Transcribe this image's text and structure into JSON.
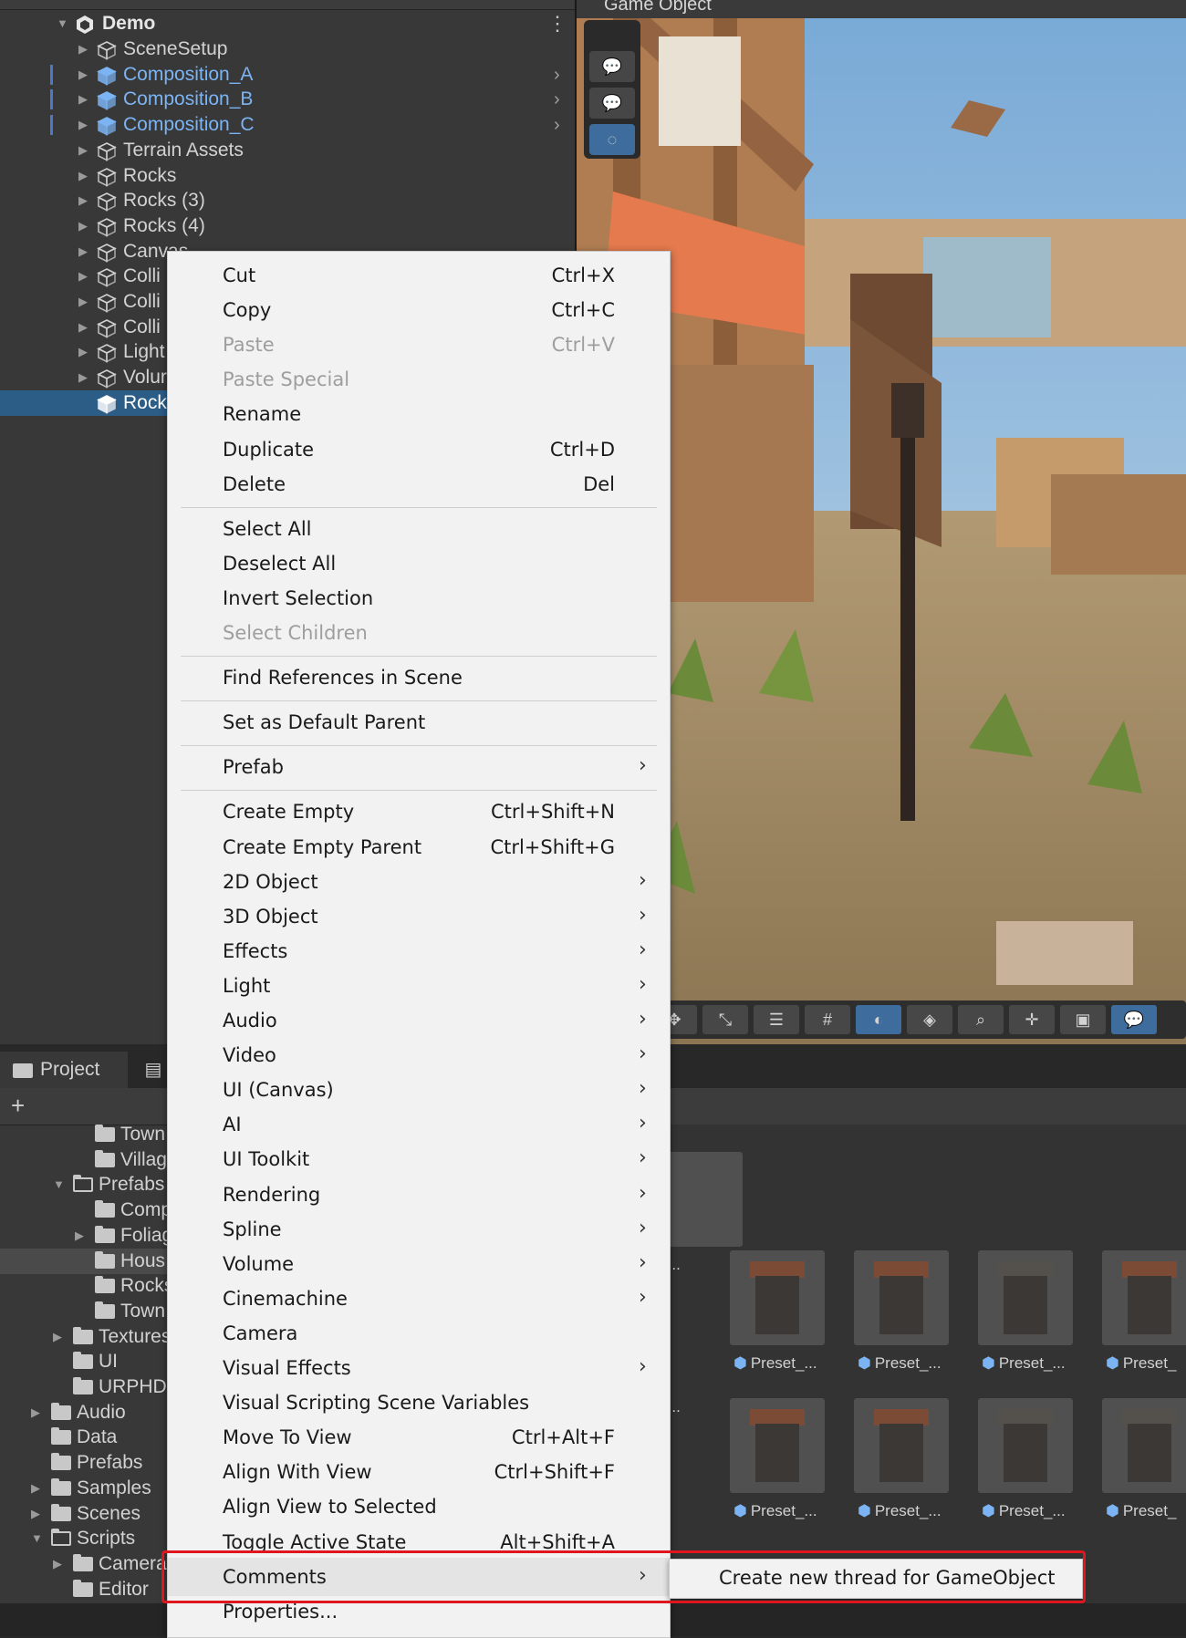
{
  "hierarchy": {
    "root": "Demo",
    "items": [
      {
        "label": "SceneSetup",
        "type": "normal"
      },
      {
        "label": "Composition_A",
        "type": "prefab"
      },
      {
        "label": "Composition_B",
        "type": "prefab"
      },
      {
        "label": "Composition_C",
        "type": "prefab"
      },
      {
        "label": "Terrain Assets",
        "type": "normal"
      },
      {
        "label": "Rocks",
        "type": "normal"
      },
      {
        "label": "Rocks (3)",
        "type": "normal"
      },
      {
        "label": "Rocks (4)",
        "type": "normal"
      },
      {
        "label": "Canvas",
        "type": "normal"
      },
      {
        "label": "Colli",
        "type": "normal"
      },
      {
        "label": "Colli",
        "type": "normal"
      },
      {
        "label": "Colli",
        "type": "normal"
      },
      {
        "label": "Light",
        "type": "normal"
      },
      {
        "label": "Volur",
        "type": "normal"
      },
      {
        "label": "Rock",
        "type": "selected"
      }
    ]
  },
  "scene": {
    "toolbar_label": "Game Object"
  },
  "project": {
    "tab_label": "Project",
    "add_label": "+",
    "tree": [
      {
        "label": "Town",
        "indent": 2
      },
      {
        "label": "Villag",
        "indent": 2
      },
      {
        "label": "Prefabs",
        "indent": 1,
        "open": true
      },
      {
        "label": "Comp",
        "indent": 2
      },
      {
        "label": "Foliag",
        "indent": 2
      },
      {
        "label": "Hous",
        "indent": 2
      },
      {
        "label": "Rocks",
        "indent": 2
      },
      {
        "label": "Town",
        "indent": 2
      },
      {
        "label": "Textures",
        "indent": 1
      },
      {
        "label": "UI",
        "indent": 1
      },
      {
        "label": "URPHD",
        "indent": 1
      },
      {
        "label": "Audio",
        "indent": 0
      },
      {
        "label": "Data",
        "indent": 0
      },
      {
        "label": "Prefabs",
        "indent": 0
      },
      {
        "label": "Samples",
        "indent": 0
      },
      {
        "label": "Scenes",
        "indent": 0
      },
      {
        "label": "Scripts",
        "indent": 0,
        "open": true
      },
      {
        "label": "Camera",
        "indent": 1
      },
      {
        "label": "Editor",
        "indent": 1
      }
    ],
    "asset_row1_left_caption": "et_...",
    "asset_row2_left_caption": "et_...",
    "assets": [
      "Preset_...",
      "Preset_...",
      "Preset_...",
      "Preset_"
    ]
  },
  "menu": {
    "items": [
      {
        "label": "Cut",
        "shortcut": "Ctrl+X"
      },
      {
        "label": "Copy",
        "shortcut": "Ctrl+C"
      },
      {
        "label": "Paste",
        "shortcut": "Ctrl+V",
        "disabled": true
      },
      {
        "label": "Paste Special",
        "disabled": true
      },
      {
        "label": "Rename"
      },
      {
        "label": "Duplicate",
        "shortcut": "Ctrl+D"
      },
      {
        "label": "Delete",
        "shortcut": "Del"
      },
      {
        "sep": true
      },
      {
        "label": "Select All"
      },
      {
        "label": "Deselect All"
      },
      {
        "label": "Invert Selection"
      },
      {
        "label": "Select Children",
        "disabled": true
      },
      {
        "sep": true
      },
      {
        "label": "Find References in Scene"
      },
      {
        "sep": true
      },
      {
        "label": "Set as Default Parent"
      },
      {
        "sep": true
      },
      {
        "label": "Prefab",
        "submenu": true
      },
      {
        "sep": true
      },
      {
        "label": "Create Empty",
        "shortcut": "Ctrl+Shift+N"
      },
      {
        "label": "Create Empty Parent",
        "shortcut": "Ctrl+Shift+G"
      },
      {
        "label": "2D Object",
        "submenu": true
      },
      {
        "label": "3D Object",
        "submenu": true
      },
      {
        "label": "Effects",
        "submenu": true
      },
      {
        "label": "Light",
        "submenu": true
      },
      {
        "label": "Audio",
        "submenu": true
      },
      {
        "label": "Video",
        "submenu": true
      },
      {
        "label": "UI (Canvas)",
        "submenu": true
      },
      {
        "label": "AI",
        "submenu": true
      },
      {
        "label": "UI Toolkit",
        "submenu": true
      },
      {
        "label": "Rendering",
        "submenu": true
      },
      {
        "label": "Spline",
        "submenu": true
      },
      {
        "label": "Volume",
        "submenu": true
      },
      {
        "label": "Cinemachine",
        "submenu": true
      },
      {
        "label": "Camera"
      },
      {
        "label": "Visual Effects",
        "submenu": true
      },
      {
        "label": "Visual Scripting Scene Variables"
      },
      {
        "label": "Move To View",
        "shortcut": "Ctrl+Alt+F"
      },
      {
        "label": "Align With View",
        "shortcut": "Ctrl+Shift+F"
      },
      {
        "label": "Align View to Selected"
      },
      {
        "label": "Toggle Active State",
        "shortcut": "Alt+Shift+A"
      },
      {
        "label": "Comments",
        "submenu": true,
        "highlighted": true
      },
      {
        "label": "Properties..."
      }
    ]
  },
  "submenu": {
    "label": "Create new thread for GameObject"
  },
  "colors": {
    "annotation": "#e0161f",
    "prefab_text": "#7cb4f3",
    "selection": "#2c5d87"
  }
}
